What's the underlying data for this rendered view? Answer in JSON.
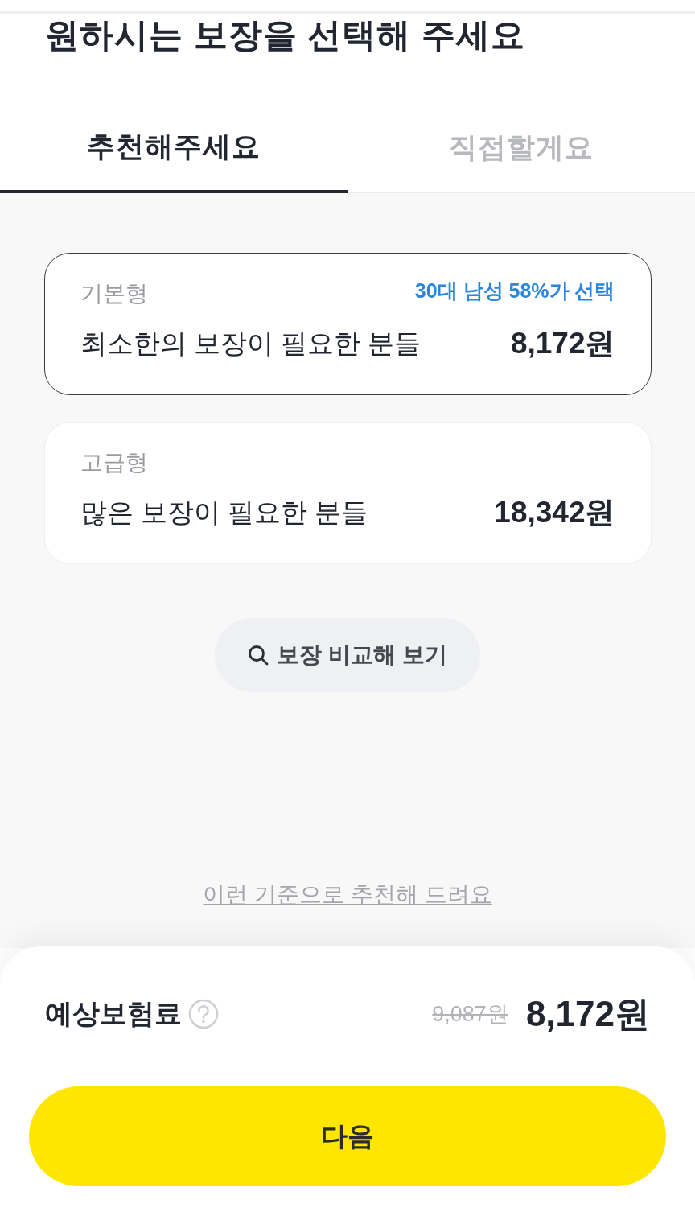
{
  "title": "원하시는 보장을 선택해 주세요",
  "tabs": [
    {
      "label": "추천해주세요",
      "selected": true
    },
    {
      "label": "직접할게요",
      "selected": false
    }
  ],
  "plans": [
    {
      "name": "기본형",
      "badge": "30대 남성 58%가 선택",
      "description": "최소한의 보장이 필요한 분들",
      "price": "8,172원",
      "selected": true
    },
    {
      "name": "고급형",
      "description": "많은 보장이 필요한 분들",
      "price": "18,342원",
      "selected": false
    }
  ],
  "compare_button": {
    "label": "보장 비교해 보기"
  },
  "criteria_link": "이런 기준으로 추천해 드려요",
  "summary": {
    "label": "예상보험료",
    "original_price": "9,087원",
    "price": "8,172원"
  },
  "next_button": {
    "label": "다음"
  }
}
